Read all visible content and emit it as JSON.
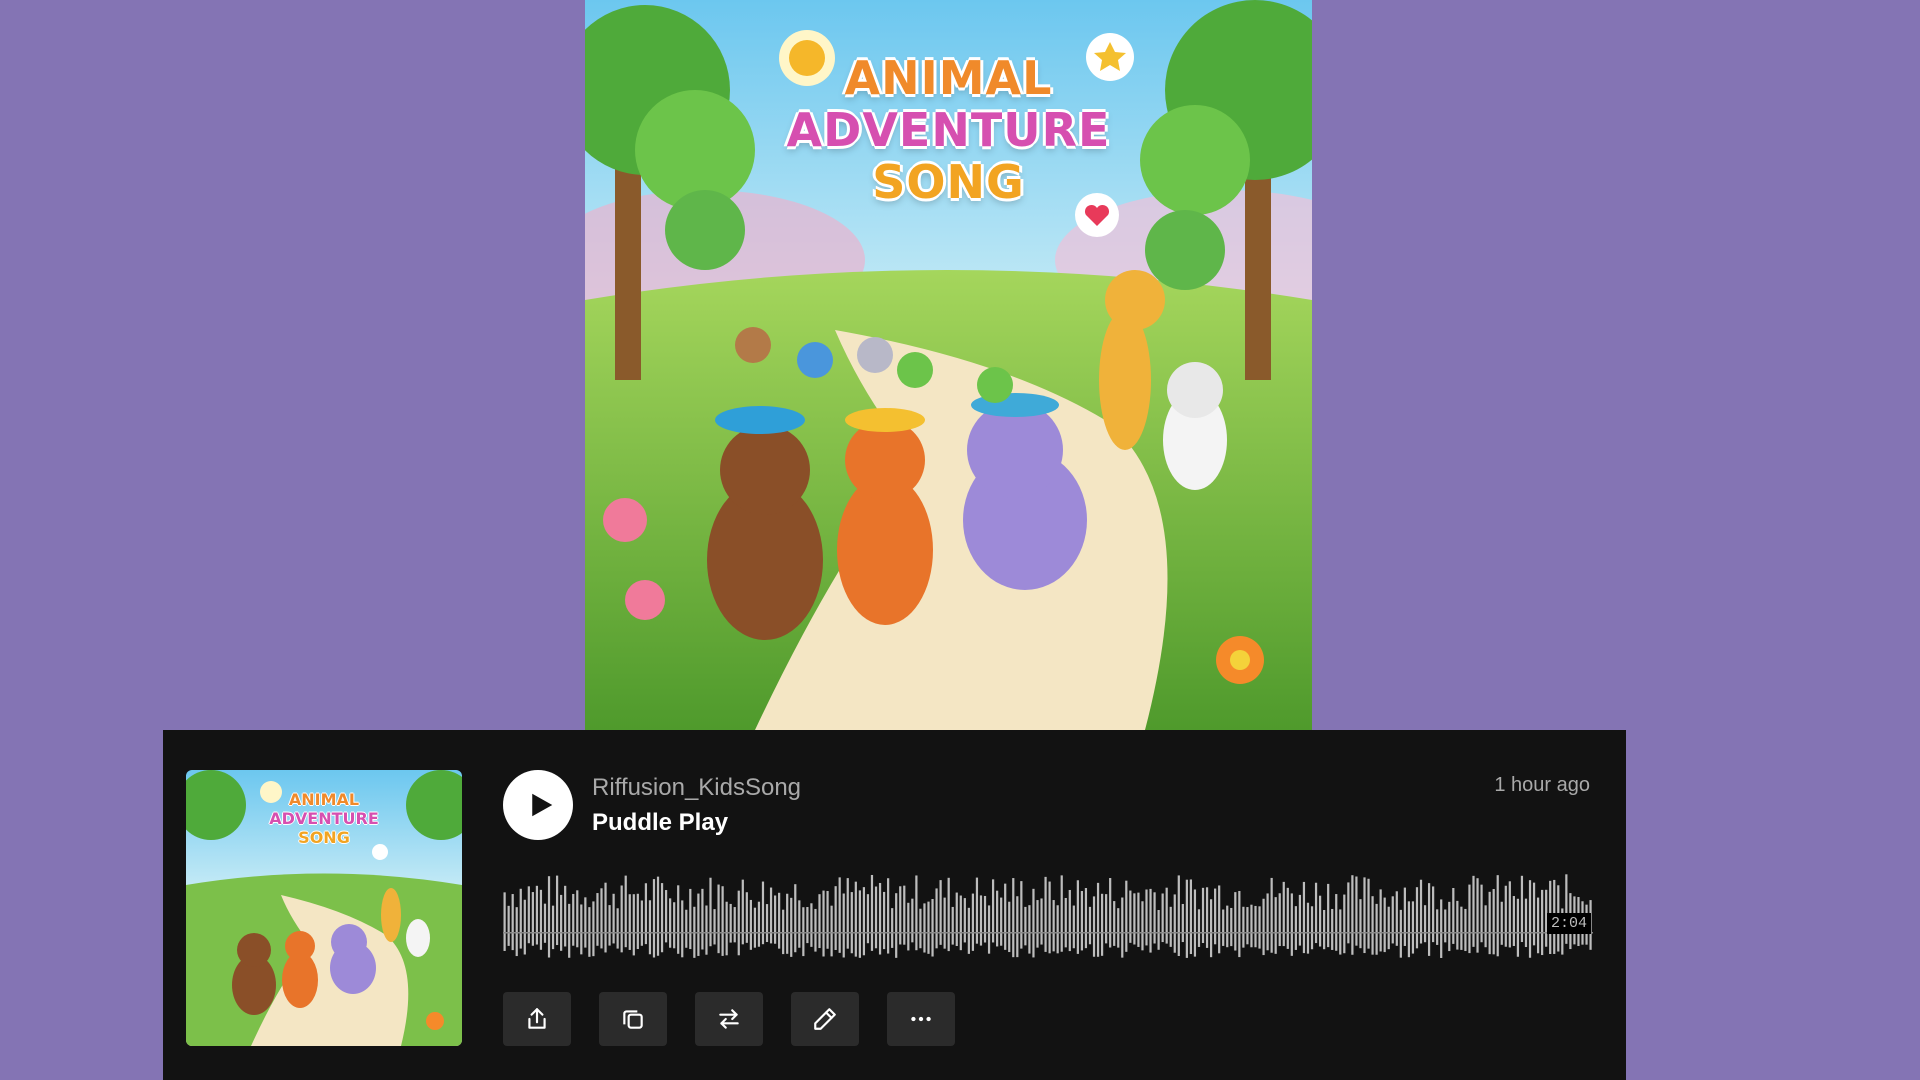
{
  "cover": {
    "title_line1": "ANIMAL",
    "title_line2": "ADVENTURE",
    "title_line3": "SONG"
  },
  "player": {
    "artist": "Riffusion_KidsSong",
    "title": "Puddle Play",
    "posted": "1 hour ago",
    "duration": "2:04",
    "actions": [
      {
        "icon": "share-icon"
      },
      {
        "icon": "copy-icon"
      },
      {
        "icon": "swap-icon"
      },
      {
        "icon": "edit-icon"
      },
      {
        "icon": "more-icon"
      }
    ]
  },
  "colors": {
    "background": "#8474b4",
    "player_bg": "#121212",
    "button_bg": "#2b2b2b",
    "waveform": "#bdbdbd"
  }
}
